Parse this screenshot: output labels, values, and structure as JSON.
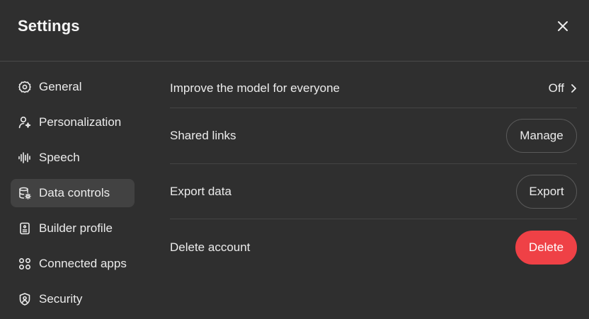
{
  "header": {
    "title": "Settings",
    "close_icon": "close-icon"
  },
  "sidebar": {
    "items": [
      {
        "label": "General",
        "icon": "gear-icon",
        "active": false
      },
      {
        "label": "Personalization",
        "icon": "user-sparkle-icon",
        "active": false
      },
      {
        "label": "Speech",
        "icon": "waveform-icon",
        "active": false
      },
      {
        "label": "Data controls",
        "icon": "database-gear-icon",
        "active": true
      },
      {
        "label": "Builder profile",
        "icon": "id-card-icon",
        "active": false
      },
      {
        "label": "Connected apps",
        "icon": "apps-grid-icon",
        "active": false
      },
      {
        "label": "Security",
        "icon": "shield-user-icon",
        "active": false
      }
    ]
  },
  "main": {
    "rows": [
      {
        "label": "Improve the model for everyone",
        "value": "Off"
      },
      {
        "label": "Shared links",
        "button": "Manage"
      },
      {
        "label": "Export data",
        "button": "Export"
      },
      {
        "label": "Delete account",
        "button": "Delete"
      }
    ]
  },
  "colors": {
    "background": "#2f2f2f",
    "active_item": "#424242",
    "danger": "#ef4146",
    "divider": "#444444"
  }
}
